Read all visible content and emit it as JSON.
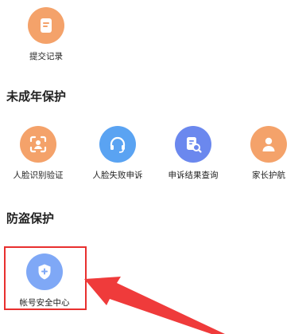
{
  "colors": {
    "orange": "#f4a26a",
    "blue": "#5aa3f2",
    "indigo": "#6b88ee",
    "shield_blue": "#7fa8f6",
    "highlight_red": "#e8302f"
  },
  "top": {
    "items": [
      {
        "label": "提交记录",
        "icon": "document-icon",
        "color": "orange"
      }
    ]
  },
  "minor_protection": {
    "title": "未成年保护",
    "items": [
      {
        "label": "人脸识别验证",
        "icon": "face-scan-icon",
        "color": "orange"
      },
      {
        "label": "人脸失败申诉",
        "icon": "headset-icon",
        "color": "blue"
      },
      {
        "label": "申诉结果查询",
        "icon": "search-document-icon",
        "color": "indigo"
      },
      {
        "label": "家长护航",
        "icon": "person-icon",
        "color": "orange"
      }
    ]
  },
  "anti_theft": {
    "title": "防盗保护",
    "items": [
      {
        "label": "帐号安全中心",
        "icon": "shield-icon",
        "color": "shield_blue"
      }
    ]
  }
}
